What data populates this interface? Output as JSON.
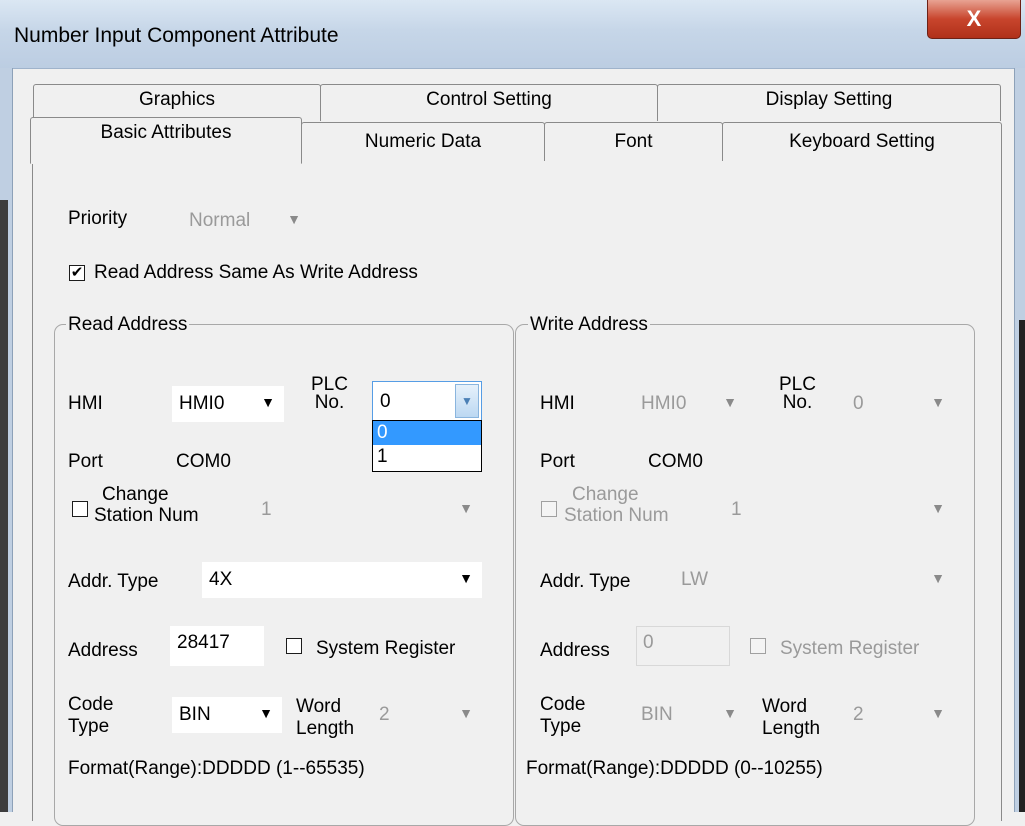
{
  "window": {
    "title": "Number Input Component Attribute",
    "close_glyph": "X"
  },
  "tabs_back": [
    "Graphics",
    "Control Setting",
    "Display Setting"
  ],
  "tabs_front": [
    "Basic Attributes",
    "Numeric Data",
    "Font",
    "Keyboard Setting"
  ],
  "selected_tab": "Basic Attributes",
  "priority": {
    "label": "Priority",
    "value": "Normal"
  },
  "same_address": {
    "label": "Read Address Same As Write Address",
    "checked": true,
    "check_glyph": "✔"
  },
  "read": {
    "legend": "Read Address",
    "hmi_label": "HMI",
    "hmi_value": "HMI0",
    "plc_label_1": "PLC",
    "plc_label_2": "No.",
    "plc_value": "0",
    "plc_options": [
      "0",
      "1"
    ],
    "port_label": "Port",
    "port_value": "COM0",
    "change_station_1": "Change",
    "change_station_2": "Station Num",
    "station_value": "1",
    "addr_type_label": "Addr. Type",
    "addr_type_value": "4X",
    "address_label": "Address",
    "address_value": "28417",
    "system_register_label": "System Register",
    "code_type_1": "Code",
    "code_type_2": "Type",
    "code_type_value": "BIN",
    "word_length_1": "Word",
    "word_length_2": "Length",
    "word_length_value": "2",
    "format": "Format(Range):DDDDD (1--65535)"
  },
  "write": {
    "legend": "Write Address",
    "hmi_label": "HMI",
    "hmi_value": "HMI0",
    "plc_label_1": "PLC",
    "plc_label_2": "No.",
    "plc_value": "0",
    "port_label": "Port",
    "port_value": "COM0",
    "change_station_1": "Change",
    "change_station_2": "Station Num",
    "station_value": "1",
    "addr_type_label": "Addr. Type",
    "addr_type_value": "LW",
    "address_label": "Address",
    "address_value": "0",
    "system_register_label": "System Register",
    "code_type_1": "Code",
    "code_type_2": "Type",
    "code_type_value": "BIN",
    "word_length_1": "Word",
    "word_length_2": "Length",
    "word_length_value": "2",
    "format": "Format(Range):DDDDD (0--10255)"
  },
  "icons": {
    "dropdown_arrow": "▼"
  }
}
